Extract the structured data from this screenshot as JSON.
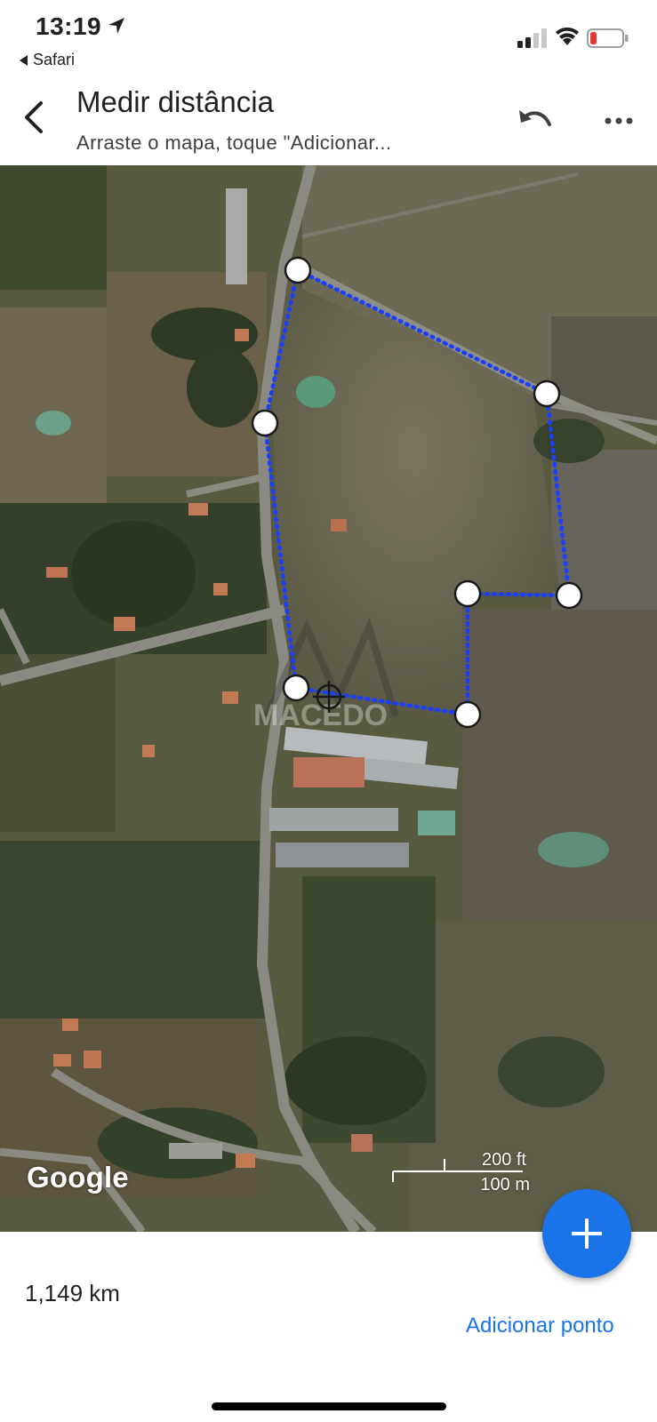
{
  "status_bar": {
    "time": "13:19",
    "back_app": "Safari",
    "icons": [
      "location-arrow-icon",
      "cellular-signal-icon",
      "wifi-icon",
      "battery-low-icon"
    ],
    "battery_color": "#e53935"
  },
  "header": {
    "title": "Medir distância",
    "subtitle": "Arraste o mapa, toque \"Adicionar...",
    "icons": [
      "back-arrow-icon",
      "undo-icon",
      "more-options-icon"
    ]
  },
  "map": {
    "view": "satellite",
    "logo": "Google",
    "scale_ft": "200 ft",
    "scale_m": "100 m",
    "watermark": "MACEDO",
    "measure_color": "#1a3fff"
  },
  "fab": {
    "icon": "plus-icon",
    "color": "#1a73e8"
  },
  "bottom": {
    "distance": "1,149 km",
    "add_point_label": "Adicionar ponto",
    "accent": "#1a73e8"
  }
}
